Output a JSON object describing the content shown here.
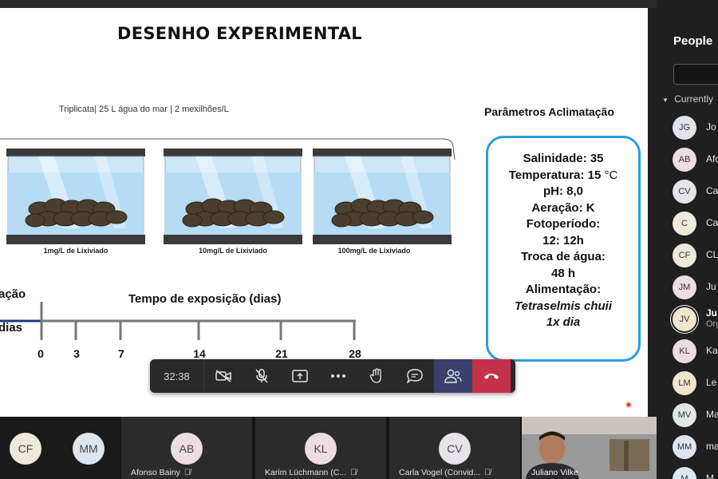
{
  "slide": {
    "title": "DESENHO EXPERIMENTAL",
    "subtitle": "Triplicata| 25 L água do mar | 2 mexilhões/L",
    "tanks": [
      {
        "label": "1mg/L de Lixiviado"
      },
      {
        "label": "10mg/L de Lixiviado"
      },
      {
        "label": "100mg/L de Lixiviado"
      }
    ],
    "params_title": "Parâmetros Aclimatação",
    "params": {
      "salinity": "Salinidade: 35",
      "temperature": "Temperatura: 15",
      "temperature_unit": "°C",
      "ph": "pH: 8,0",
      "aeration": "Aeração: K",
      "photoperiod_label": "Fotoperíodo:",
      "photoperiod_value": "12: 12h",
      "water_exchange_label": "Troca de água:",
      "water_exchange_value": "48 h",
      "feeding_label": "Alimentação:",
      "feeding_species": "Tetraselmis chuii",
      "feeding_freq": "1x dia"
    },
    "left_fragment_1": "ação",
    "left_fragment_2": "dias",
    "timeline_title": "Tempo de exposição (dias)",
    "timeline_ticks": [
      "0",
      "3",
      "7",
      "14",
      "21",
      "28"
    ]
  },
  "toolbar": {
    "timer": "32:38",
    "buttons": [
      "camera-off",
      "mic-off",
      "share",
      "more",
      "raise-hand",
      "chat",
      "people",
      "hang-up"
    ]
  },
  "people_panel": {
    "title": "People",
    "section": "Currently",
    "participants": [
      {
        "initials": "JG",
        "name": "Jo",
        "color": "#dfe3ec"
      },
      {
        "initials": "AB",
        "name": "Afo",
        "color": "#ecdde4"
      },
      {
        "initials": "CV",
        "name": "Ca",
        "color": "#e8e3ea"
      },
      {
        "initials": "C",
        "name": "Ca",
        "color": "#efeadc"
      },
      {
        "initials": "CF",
        "name": "CL",
        "color": "#eeeadb"
      },
      {
        "initials": "JM",
        "name": "Ju",
        "color": "#ecdde4"
      },
      {
        "initials": "JV",
        "name": "Ju",
        "sub": "Org",
        "color": "#efe6cf"
      },
      {
        "initials": "KL",
        "name": "Ka",
        "color": "#ecdde4"
      },
      {
        "initials": "LM",
        "name": "Le",
        "color": "#efe6cf"
      },
      {
        "initials": "MV",
        "name": "Ma",
        "color": "#dfe8e3"
      },
      {
        "initials": "MM",
        "name": "ma",
        "color": "#dde6ef"
      },
      {
        "initials": "M",
        "name": "M",
        "color": "#dde6ef"
      }
    ]
  },
  "bottom_strip": {
    "tiles": [
      {
        "initials": "CF",
        "name": "",
        "color": "#eeeadb"
      },
      {
        "initials": "MM",
        "name": "",
        "color": "#dde6ef"
      },
      {
        "initials": "AB",
        "name": "Afonso Bainy",
        "color": "#ecdde4"
      },
      {
        "initials": "KL",
        "name": "Karim Lüchmann (C...",
        "color": "#ecdde4"
      },
      {
        "initials": "CV",
        "name": "Carla Vogel (Convid...",
        "color": "#e8e3ea"
      }
    ],
    "video_name": "Juliano Vilke"
  }
}
